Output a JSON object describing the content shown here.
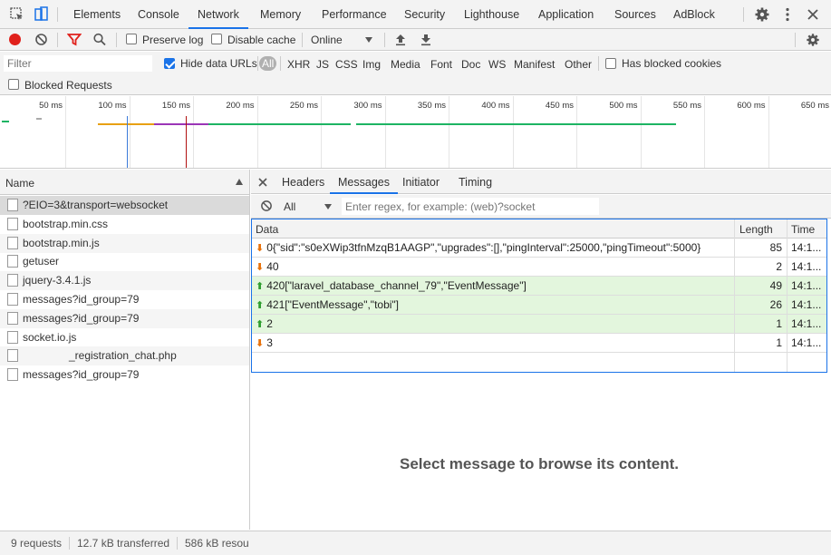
{
  "tabs": [
    "Elements",
    "Console",
    "Network",
    "Memory",
    "Performance",
    "Security",
    "Lighthouse",
    "Application",
    "Sources",
    "AdBlock"
  ],
  "active_tab": "Network",
  "toolbar": {
    "preserve_log": "Preserve log",
    "disable_cache": "Disable cache",
    "throttle": "Online"
  },
  "filter": {
    "placeholder": "Filter",
    "hide_data_urls": "Hide data URLs",
    "types": [
      "All",
      "XHR",
      "JS",
      "CSS",
      "Img",
      "Media",
      "Font",
      "Doc",
      "WS",
      "Manifest",
      "Other"
    ],
    "has_blocked_cookies": "Has blocked cookies",
    "blocked_requests": "Blocked Requests"
  },
  "overview": {
    "ticks": [
      "50 ms",
      "100 ms",
      "150 ms",
      "200 ms",
      "250 ms",
      "300 ms",
      "350 ms",
      "400 ms",
      "450 ms",
      "500 ms",
      "550 ms",
      "600 ms",
      "650 ms"
    ],
    "colors": {
      "orange": "#e8a013",
      "purple": "#9b36b7",
      "green": "#1db463",
      "blue": "#3b7ad9",
      "red": "#b01010"
    }
  },
  "requests": {
    "header": "Name",
    "items": [
      "?EIO=3&transport=websocket",
      "bootstrap.min.css",
      "bootstrap.min.js",
      "getuser",
      "jquery-3.4.1.js",
      "messages?id_group=79",
      "messages?id_group=79",
      "socket.io.js",
      "_registration_chat.php",
      "messages?id_group=79"
    ]
  },
  "detail_tabs": [
    "Headers",
    "Messages",
    "Initiator",
    "Timing"
  ],
  "active_detail_tab": "Messages",
  "messages_filter": {
    "select": "All",
    "placeholder": "Enter regex, for example: (web)?socket"
  },
  "messages": {
    "columns": [
      "Data",
      "Length",
      "Time"
    ],
    "rows": [
      {
        "dir": "down",
        "data": "0{\"sid\":\"s0eXWip3tfnMzqB1AAGP\",\"upgrades\":[],\"pingInterval\":25000,\"pingTimeout\":5000}",
        "length": "85",
        "time": "14:1..."
      },
      {
        "dir": "down",
        "data": "40",
        "length": "2",
        "time": "14:1..."
      },
      {
        "dir": "up",
        "data": "420[\"laravel_database_channel_79\",\"EventMessage\"]",
        "length": "49",
        "time": "14:1..."
      },
      {
        "dir": "up",
        "data": "421[\"EventMessage\",\"tobi\"]",
        "length": "26",
        "time": "14:1..."
      },
      {
        "dir": "up",
        "data": "2",
        "length": "1",
        "time": "14:1..."
      },
      {
        "dir": "down",
        "data": "3",
        "length": "1",
        "time": "14:1..."
      }
    ],
    "placeholder": "Select message to browse its content."
  },
  "status": {
    "requests": "9 requests",
    "transferred": "12.7 kB transferred",
    "resources": "586 kB resou"
  }
}
